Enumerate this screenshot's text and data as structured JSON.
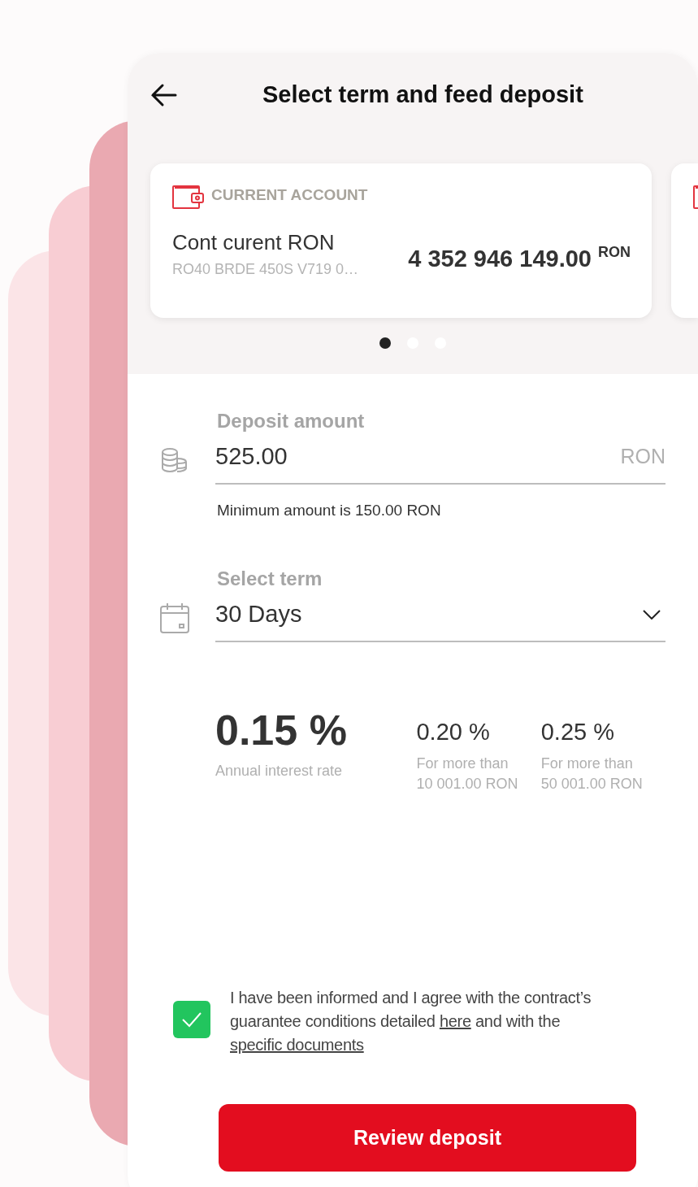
{
  "header": {
    "title": "Select term and feed deposit"
  },
  "accounts": [
    {
      "type_label": "CURRENT ACCOUNT",
      "name": "Cont curent RON",
      "iban": "RO40 BRDE 450S V719 0…",
      "balance": "4 352 946 149.00",
      "currency": "RON"
    }
  ],
  "carousel_dots": [
    {
      "selected": true
    },
    {
      "selected": false
    },
    {
      "selected": false
    }
  ],
  "amount_field": {
    "label": "Deposit amount",
    "value": "525.00",
    "currency": "RON",
    "hint": "Minimum amount is 150.00 RON"
  },
  "term_field": {
    "label": "Select term",
    "value": "30 Days"
  },
  "rates": [
    {
      "kind": "main",
      "rate": "0.15 %",
      "caption": "Annual interest rate"
    },
    {
      "kind": "tier",
      "rate": "0.20 %",
      "caption": "For more than 10 001.00 RON"
    },
    {
      "kind": "tier",
      "rate": "0.25 %",
      "caption": "For more than 50 001.00 RON"
    }
  ],
  "agreement": {
    "checked": true,
    "parts": [
      {
        "kind": "text",
        "text": "I have been informed and I agree with the contract’s guarantee conditions detailed"
      },
      {
        "kind": "link",
        "text": "here"
      },
      {
        "kind": "text",
        "text": "and with the"
      },
      {
        "kind": "link",
        "text": "specific documents"
      }
    ]
  },
  "button": {
    "label": "Review deposit"
  }
}
